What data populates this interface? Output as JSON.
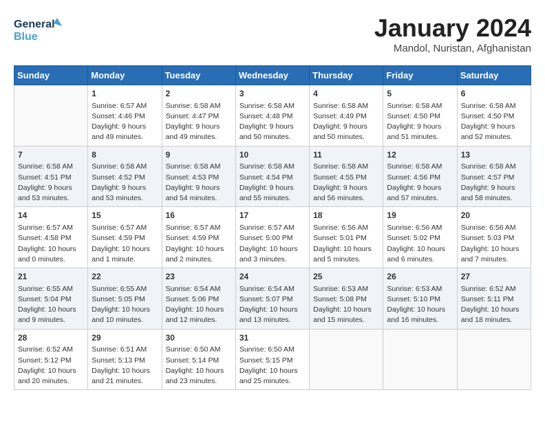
{
  "header": {
    "logo_line1": "General",
    "logo_line2": "Blue",
    "month_title": "January 2024",
    "location": "Mandol, Nuristan, Afghanistan"
  },
  "days_of_week": [
    "Sunday",
    "Monday",
    "Tuesday",
    "Wednesday",
    "Thursday",
    "Friday",
    "Saturday"
  ],
  "weeks": [
    [
      {
        "num": "",
        "info": ""
      },
      {
        "num": "1",
        "info": "Sunrise: 6:57 AM\nSunset: 4:46 PM\nDaylight: 9 hours\nand 49 minutes."
      },
      {
        "num": "2",
        "info": "Sunrise: 6:58 AM\nSunset: 4:47 PM\nDaylight: 9 hours\nand 49 minutes."
      },
      {
        "num": "3",
        "info": "Sunrise: 6:58 AM\nSunset: 4:48 PM\nDaylight: 9 hours\nand 50 minutes."
      },
      {
        "num": "4",
        "info": "Sunrise: 6:58 AM\nSunset: 4:49 PM\nDaylight: 9 hours\nand 50 minutes."
      },
      {
        "num": "5",
        "info": "Sunrise: 6:58 AM\nSunset: 4:50 PM\nDaylight: 9 hours\nand 51 minutes."
      },
      {
        "num": "6",
        "info": "Sunrise: 6:58 AM\nSunset: 4:50 PM\nDaylight: 9 hours\nand 52 minutes."
      }
    ],
    [
      {
        "num": "7",
        "info": "Sunrise: 6:58 AM\nSunset: 4:51 PM\nDaylight: 9 hours\nand 53 minutes."
      },
      {
        "num": "8",
        "info": "Sunrise: 6:58 AM\nSunset: 4:52 PM\nDaylight: 9 hours\nand 53 minutes."
      },
      {
        "num": "9",
        "info": "Sunrise: 6:58 AM\nSunset: 4:53 PM\nDaylight: 9 hours\nand 54 minutes."
      },
      {
        "num": "10",
        "info": "Sunrise: 6:58 AM\nSunset: 4:54 PM\nDaylight: 9 hours\nand 55 minutes."
      },
      {
        "num": "11",
        "info": "Sunrise: 6:58 AM\nSunset: 4:55 PM\nDaylight: 9 hours\nand 56 minutes."
      },
      {
        "num": "12",
        "info": "Sunrise: 6:58 AM\nSunset: 4:56 PM\nDaylight: 9 hours\nand 57 minutes."
      },
      {
        "num": "13",
        "info": "Sunrise: 6:58 AM\nSunset: 4:57 PM\nDaylight: 9 hours\nand 58 minutes."
      }
    ],
    [
      {
        "num": "14",
        "info": "Sunrise: 6:57 AM\nSunset: 4:58 PM\nDaylight: 10 hours\nand 0 minutes."
      },
      {
        "num": "15",
        "info": "Sunrise: 6:57 AM\nSunset: 4:59 PM\nDaylight: 10 hours\nand 1 minute."
      },
      {
        "num": "16",
        "info": "Sunrise: 6:57 AM\nSunset: 4:59 PM\nDaylight: 10 hours\nand 2 minutes."
      },
      {
        "num": "17",
        "info": "Sunrise: 6:57 AM\nSunset: 5:00 PM\nDaylight: 10 hours\nand 3 minutes."
      },
      {
        "num": "18",
        "info": "Sunrise: 6:56 AM\nSunset: 5:01 PM\nDaylight: 10 hours\nand 5 minutes."
      },
      {
        "num": "19",
        "info": "Sunrise: 6:56 AM\nSunset: 5:02 PM\nDaylight: 10 hours\nand 6 minutes."
      },
      {
        "num": "20",
        "info": "Sunrise: 6:56 AM\nSunset: 5:03 PM\nDaylight: 10 hours\nand 7 minutes."
      }
    ],
    [
      {
        "num": "21",
        "info": "Sunrise: 6:55 AM\nSunset: 5:04 PM\nDaylight: 10 hours\nand 9 minutes."
      },
      {
        "num": "22",
        "info": "Sunrise: 6:55 AM\nSunset: 5:05 PM\nDaylight: 10 hours\nand 10 minutes."
      },
      {
        "num": "23",
        "info": "Sunrise: 6:54 AM\nSunset: 5:06 PM\nDaylight: 10 hours\nand 12 minutes."
      },
      {
        "num": "24",
        "info": "Sunrise: 6:54 AM\nSunset: 5:07 PM\nDaylight: 10 hours\nand 13 minutes."
      },
      {
        "num": "25",
        "info": "Sunrise: 6:53 AM\nSunset: 5:08 PM\nDaylight: 10 hours\nand 15 minutes."
      },
      {
        "num": "26",
        "info": "Sunrise: 6:53 AM\nSunset: 5:10 PM\nDaylight: 10 hours\nand 16 minutes."
      },
      {
        "num": "27",
        "info": "Sunrise: 6:52 AM\nSunset: 5:11 PM\nDaylight: 10 hours\nand 18 minutes."
      }
    ],
    [
      {
        "num": "28",
        "info": "Sunrise: 6:52 AM\nSunset: 5:12 PM\nDaylight: 10 hours\nand 20 minutes."
      },
      {
        "num": "29",
        "info": "Sunrise: 6:51 AM\nSunset: 5:13 PM\nDaylight: 10 hours\nand 21 minutes."
      },
      {
        "num": "30",
        "info": "Sunrise: 6:50 AM\nSunset: 5:14 PM\nDaylight: 10 hours\nand 23 minutes."
      },
      {
        "num": "31",
        "info": "Sunrise: 6:50 AM\nSunset: 5:15 PM\nDaylight: 10 hours\nand 25 minutes."
      },
      {
        "num": "",
        "info": ""
      },
      {
        "num": "",
        "info": ""
      },
      {
        "num": "",
        "info": ""
      }
    ]
  ]
}
